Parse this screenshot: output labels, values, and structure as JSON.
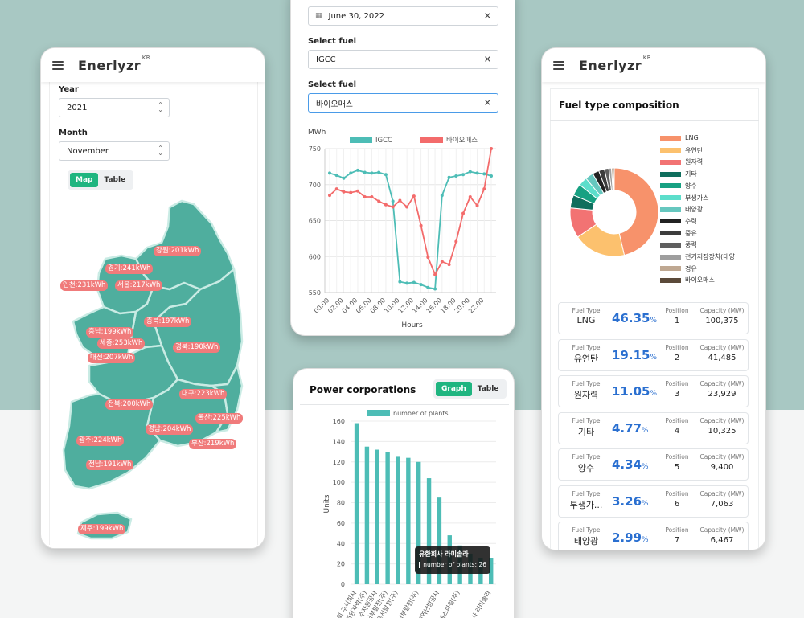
{
  "app": {
    "logo": "Enerlyzr",
    "logo_sup": "KR"
  },
  "phone1": {
    "year_label": "Year",
    "year_value": "2021",
    "month_label": "Month",
    "month_value": "November",
    "toggle": [
      "Map",
      "Table"
    ],
    "regions": [
      {
        "label": "강원:201kWh"
      },
      {
        "label": "경기:241kWh"
      },
      {
        "label": "인천:231kWh"
      },
      {
        "label": "서울:217kWh"
      },
      {
        "label": "충북:197kWh"
      },
      {
        "label": "충남:199kWh"
      },
      {
        "label": "세종:253kWh"
      },
      {
        "label": "대전:207kWh"
      },
      {
        "label": "경북:190kWh"
      },
      {
        "label": "대구:223kWh"
      },
      {
        "label": "전북:200kWh"
      },
      {
        "label": "울산:225kWh"
      },
      {
        "label": "경남:204kWh"
      },
      {
        "label": "부산:219kWh"
      },
      {
        "label": "광주:224kWh"
      },
      {
        "label": "전남:191kWh"
      },
      {
        "label": "제주:199kWh"
      }
    ],
    "map_color": "#4fae9e"
  },
  "phone2": {
    "date_value": "June 30, 2022",
    "fuel1_label": "Select fuel",
    "fuel1_value": "IGCC",
    "fuel2_label": "Select fuel",
    "fuel2_value": "바이오매스",
    "chart_data": {
      "type": "line",
      "ylabel": "MWh",
      "xlabel": "Hours",
      "ylim": [
        550,
        750
      ],
      "yticks": [
        550,
        600,
        650,
        700,
        750
      ],
      "x": [
        "00:00",
        "01:00",
        "02:00",
        "03:00",
        "04:00",
        "05:00",
        "06:00",
        "07:00",
        "08:00",
        "09:00",
        "10:00",
        "11:00",
        "12:00",
        "13:00",
        "14:00",
        "15:00",
        "16:00",
        "17:00",
        "18:00",
        "19:00",
        "20:00",
        "21:00",
        "22:00",
        "23:00"
      ],
      "xtick_labels": [
        "00:00",
        "02:00",
        "04:00",
        "06:00",
        "08:00",
        "10:00",
        "12:00",
        "14:00",
        "16:00",
        "18:00",
        "20:00",
        "22:00"
      ],
      "series": [
        {
          "name": "IGCC",
          "color": "#4dbdb6",
          "values": [
            716,
            713,
            709,
            716,
            720,
            717,
            716,
            717,
            714,
            677,
            565,
            563,
            564,
            561,
            557,
            555,
            685,
            710,
            712,
            714,
            718,
            716,
            715,
            712
          ]
        },
        {
          "name": "바이오매스",
          "color": "#f36b6b",
          "values": [
            685,
            694,
            690,
            689,
            691,
            683,
            683,
            677,
            672,
            669,
            678,
            669,
            684,
            643,
            599,
            575,
            593,
            589,
            621,
            660,
            683,
            671,
            694,
            750
          ]
        }
      ]
    }
  },
  "phone3": {
    "title": "Power corporations",
    "toggle": [
      "Graph",
      "Table"
    ],
    "tooltip_title": "유한회사 라미솔라",
    "tooltip_body": "number of plants: 26",
    "chart_data": {
      "type": "bar",
      "ylabel": "Units",
      "ylim": [
        0,
        160
      ],
      "yticks": [
        0,
        20,
        40,
        60,
        80,
        100,
        120,
        140,
        160
      ],
      "series": [
        {
          "name": "number of plants",
          "color": "#4dbdb6"
        }
      ],
      "values": [
        158,
        135,
        132,
        130,
        125,
        124,
        120,
        104,
        85,
        48,
        38,
        30,
        26,
        26
      ],
      "category_labels": [
        "주식회사",
        "한국수력원자력(주)",
        "한국수자원공사",
        "한국서부발전(주)",
        "한국동서발전(주)",
        "한국남부발전(주)",
        "한국중부발전(주)",
        "주식회사",
        "주식회사",
        "주식회사",
        "한국지역난방공사",
        "에스파워(주)",
        "유한회사",
        "유한회사 라미솔라"
      ],
      "visible_tick_labels": [
        "회 주식회사",
        "수력원자력(주)",
        "수자원공사",
        "국서부발전(주)",
        "동서발전(주)",
        "한국남부발전(주)",
        "국지역난방공사",
        "에스파워(주)",
        "유한회사 라미솔라"
      ]
    }
  },
  "phone4": {
    "title": "Fuel type composition",
    "chart_data": {
      "type": "pie",
      "labels": [
        "LNG",
        "유연탄",
        "원자력",
        "기타",
        "양수",
        "부생가스",
        "태양광",
        "수력",
        "중유",
        "풍력",
        "전기저장장치(태양",
        "경유",
        "바이오매스"
      ],
      "values": [
        46.35,
        19.15,
        11.05,
        4.77,
        4.34,
        3.26,
        2.99,
        2.4,
        2.1,
        1.6,
        1.0,
        0.6,
        0.4
      ],
      "colors": [
        "#f7926b",
        "#fcc16e",
        "#f27373",
        "#0f6e5d",
        "#17a182",
        "#5cdecb",
        "#66c7bf",
        "#222222",
        "#3d3d3d",
        "#5f5f5f",
        "#9e9e9e",
        "#bfa892",
        "#5b4a3a"
      ]
    },
    "rows": [
      {
        "type_label": "Fuel Type",
        "type": "LNG",
        "pct": "46.35",
        "pos_label": "Position",
        "pos": "1",
        "cap_label": "Capacity (MW)",
        "cap": "100,375"
      },
      {
        "type_label": "Fuel Type",
        "type": "유연탄",
        "pct": "19.15",
        "pos_label": "Position",
        "pos": "2",
        "cap_label": "Capacity (MW)",
        "cap": "41,485"
      },
      {
        "type_label": "Fuel Type",
        "type": "원자력",
        "pct": "11.05",
        "pos_label": "Position",
        "pos": "3",
        "cap_label": "Capacity (MW)",
        "cap": "23,929"
      },
      {
        "type_label": "Fuel Type",
        "type": "기타",
        "pct": "4.77",
        "pos_label": "Position",
        "pos": "4",
        "cap_label": "Capacity (MW)",
        "cap": "10,325"
      },
      {
        "type_label": "Fuel Type",
        "type": "양수",
        "pct": "4.34",
        "pos_label": "Position",
        "pos": "5",
        "cap_label": "Capacity (MW)",
        "cap": "9,400"
      },
      {
        "type_label": "Fuel Type",
        "type": "부생가...",
        "pct": "3.26",
        "pos_label": "Position",
        "pos": "6",
        "cap_label": "Capacity (MW)",
        "cap": "7,063"
      },
      {
        "type_label": "Fuel Type",
        "type": "태양광",
        "pct": "2.99",
        "pos_label": "Position",
        "pos": "7",
        "cap_label": "Capacity (MW)",
        "cap": "6,467"
      }
    ],
    "pct_suffix": "%"
  }
}
